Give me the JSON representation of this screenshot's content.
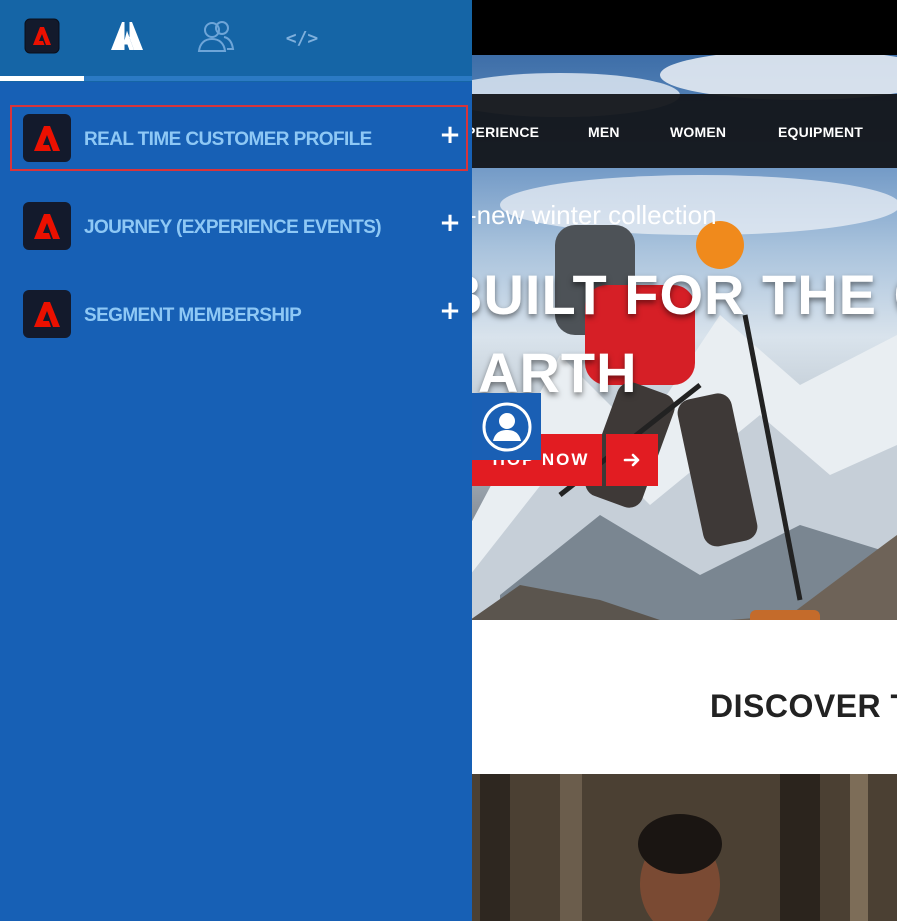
{
  "panel": {
    "tabs": [
      {
        "name": "extensions",
        "icon": "adobe-experience-platform-icon",
        "active": true
      },
      {
        "name": "adobe",
        "icon": "adobe-logo-icon",
        "active": false
      },
      {
        "name": "users",
        "icon": "users-icon",
        "active": false
      },
      {
        "name": "code",
        "icon": "code-icon",
        "label": "</>",
        "active": false
      }
    ],
    "extensions": [
      {
        "label": "REAL TIME CUSTOMER PROFILE",
        "expand": "+",
        "selected": true
      },
      {
        "label": "JOURNEY (EXPERIENCE EVENTS)",
        "expand": "+",
        "selected": false
      },
      {
        "label": "SEGMENT MEMBERSHIP",
        "expand": "+",
        "selected": false
      }
    ],
    "colors": {
      "background": "#1760b5",
      "label": "#8ec8f5",
      "selection": "#d9343a",
      "logo_bg": "#131a2c",
      "logo_red": "#eb1000"
    }
  },
  "site": {
    "nav": [
      "PERIENCE",
      "MEN",
      "WOMEN",
      "EQUIPMENT"
    ],
    "hero": {
      "kicker": "-new winter collection",
      "headline_line1": "BUILT FOR THE C",
      "headline_line2": "ARTH",
      "cta_label": "HOP NOW"
    },
    "discover_title": "DISCOVER T",
    "colors": {
      "cta": "#e21c22",
      "nav_bg": "#121418"
    }
  }
}
